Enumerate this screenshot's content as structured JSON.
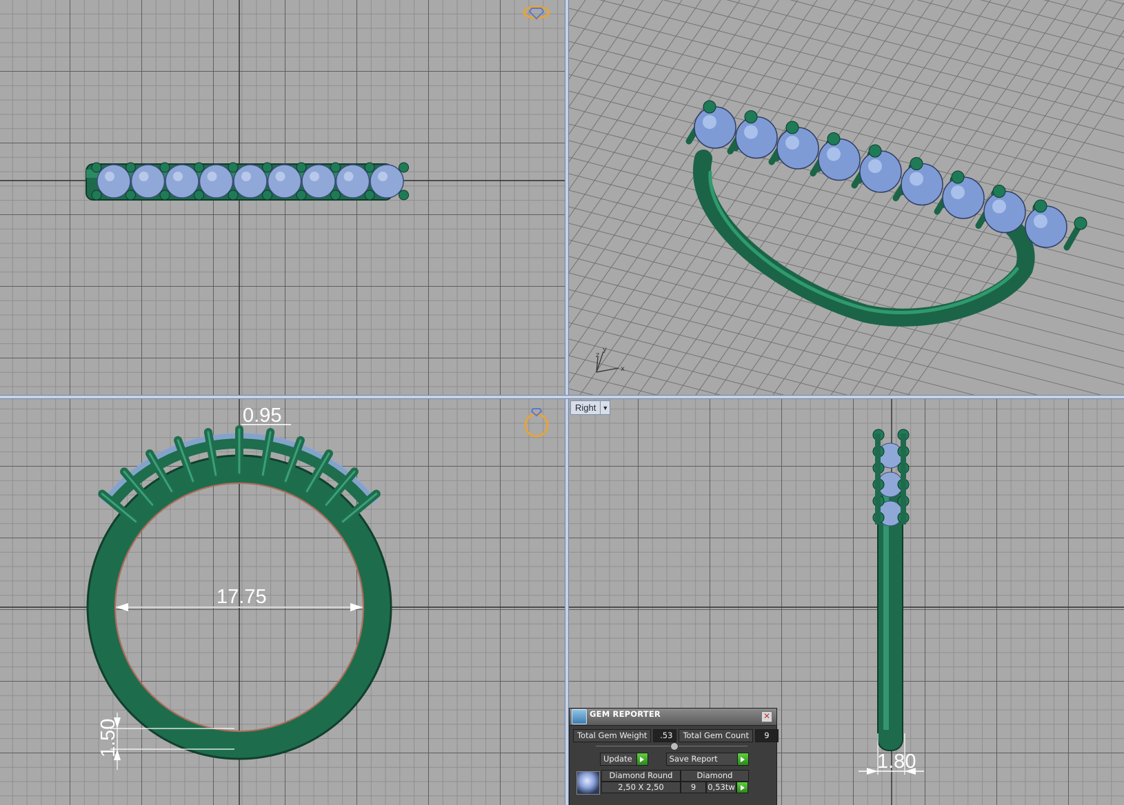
{
  "viewports": {
    "top": {},
    "perspective": {
      "axes": {
        "x": "x",
        "y": "y",
        "z": "z"
      }
    },
    "front": {
      "dimensions": {
        "prong_gap": "0.95",
        "inner_diameter": "17.75",
        "band_thickness": "1.50"
      }
    },
    "right": {
      "label": "Right",
      "dimensions": {
        "band_width": "1.80"
      }
    }
  },
  "gem_reporter": {
    "title": "GEM REPORTER",
    "total_gem_weight_label": "Total Gem Weight",
    "total_gem_weight": ".53",
    "total_gem_count_label": "Total Gem Count",
    "total_gem_count": "9",
    "update_label": "Update",
    "save_report_label": "Save Report",
    "rows": [
      {
        "shape": "Diamond Round",
        "size": "2,50 X 2,50",
        "material": "Diamond",
        "count": "9",
        "weight": "0,53tw"
      }
    ]
  },
  "colors": {
    "metal": "#1f7a57",
    "gem": "#8fa8d8",
    "grid_bg": "#a9a9a9",
    "accent": "#e6a43a"
  }
}
